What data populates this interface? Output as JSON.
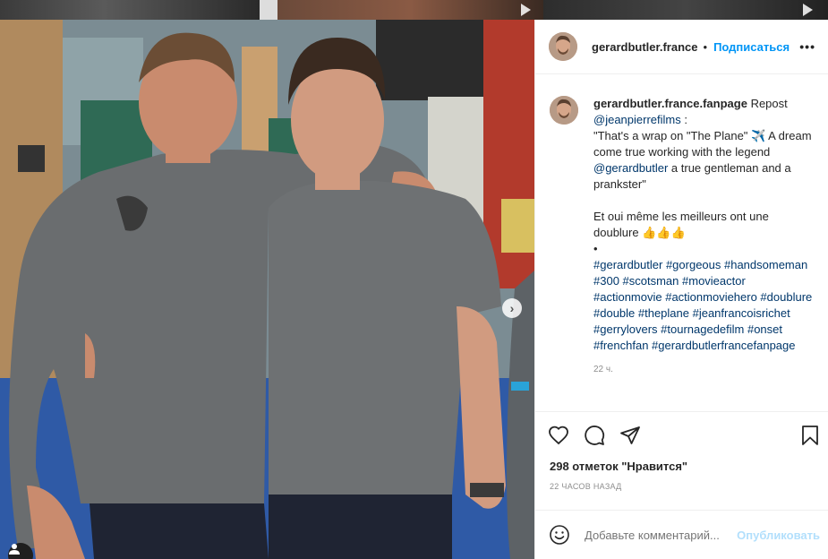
{
  "post": {
    "author": "gerardbutler.france",
    "separator": "•",
    "follow_label": "Подписаться",
    "more_label": "•••",
    "caption": {
      "username": "gerardbutler.france.fanpage",
      "text_1": " Repost",
      "mention_1": "@jeanpierrefilms",
      "text_2": " :",
      "text_3": "\"That's a wrap on \"The Plane\" ✈️ A dream come true working with the legend ",
      "mention_2": "@gerardbutler",
      "text_4": " a true gentleman and a prankster\"",
      "text_5": "Et oui même les meilleurs ont une doublure 👍👍👍",
      "bullet": "•",
      "hashtags": "#gerardbutler #gorgeous #handsomeman #300 #scotsman #movieactor #actionmovie #actionmoviehero #doublure #double #theplane #jeanfrancoisrichet #gerrylovers #tournagedefilm #onset #frenchfan #gerardbutlerfrancefanpage",
      "time": "22 ч."
    },
    "likes": "298 отметок \"Нравится\"",
    "posted_ago": "22 ЧАСОВ НАЗАД",
    "comment_placeholder": "Добавьте комментарий...",
    "publish_label": "Опубликовать",
    "carousel": {
      "count": 3,
      "active_index": 0
    }
  },
  "icons": {
    "like": "heart-icon",
    "comment": "comment-bubble-icon",
    "share": "paper-plane-icon",
    "save": "bookmark-icon",
    "emoji": "smiley-icon",
    "next": "chevron-right-icon",
    "tagged_user": "user-tag-icon"
  },
  "colors": {
    "accent": "#0095f6",
    "publish_disabled": "#b2dffc",
    "link": "#00376b",
    "carousel_active": "#3897f0"
  }
}
